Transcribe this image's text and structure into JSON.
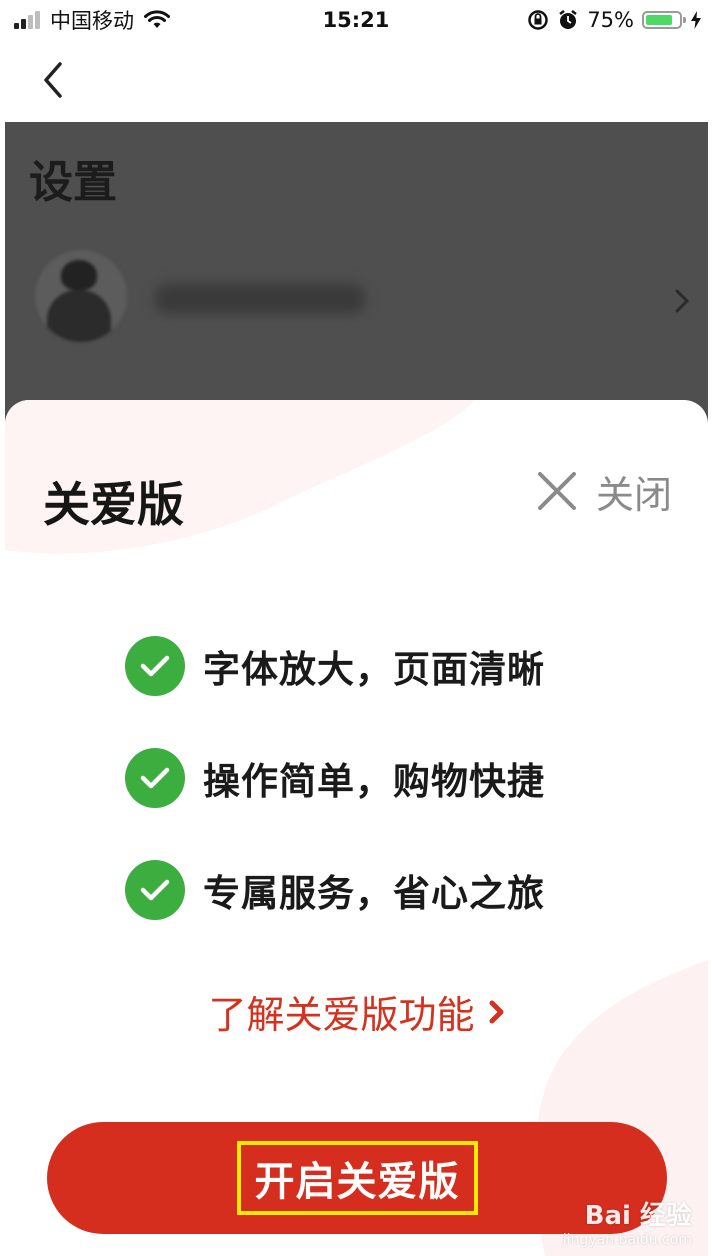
{
  "status_bar": {
    "carrier": "中国移动",
    "time": "15:21",
    "battery_percent": "75%",
    "battery_level": 0.75,
    "icons": [
      "signal-icon",
      "wifi-icon",
      "rotation-lock-icon",
      "alarm-icon",
      "battery-icon",
      "charging-icon"
    ]
  },
  "nav": {
    "back_icon": "chevron-left-icon"
  },
  "settings": {
    "title": "设置"
  },
  "sheet": {
    "title": "关爱版",
    "close_label": "关闭",
    "features": [
      {
        "text": "字体放大，页面清晰"
      },
      {
        "text": "操作简单，购物快捷"
      },
      {
        "text": "专属服务，省心之旅"
      }
    ],
    "learn_more": "了解关爱版功能",
    "enable_button": "开启关爱版"
  },
  "watermark": {
    "text": "Bai 经验",
    "sub": "jingyan.baidu.com"
  },
  "colors": {
    "accent_red": "#d52d1e",
    "check_green": "#3cad3f",
    "highlight_yellow": "#ffeb00",
    "overlay_gray": "#4f4f4f"
  }
}
